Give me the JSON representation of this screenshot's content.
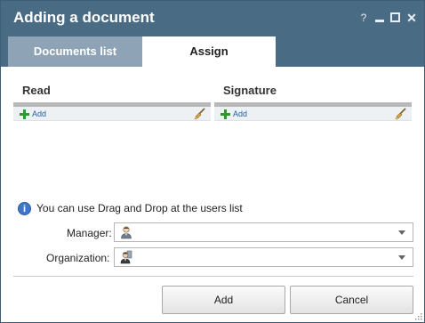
{
  "window": {
    "title": "Adding a document",
    "help_glyph": "?",
    "close_glyph": "✕"
  },
  "tabs": [
    {
      "label": "Documents list",
      "active": false
    },
    {
      "label": "Assign",
      "active": true
    }
  ],
  "panels": {
    "read": {
      "title": "Read",
      "add_label": "Add"
    },
    "signature": {
      "title": "Signature",
      "add_label": "Add"
    }
  },
  "info": {
    "icon": "i",
    "text": "You can use Drag and Drop at the users list"
  },
  "fields": {
    "manager": {
      "label": "Manager:",
      "value": ""
    },
    "organization": {
      "label": "Organization:",
      "value": ""
    }
  },
  "buttons": {
    "add": "Add",
    "cancel": "Cancel"
  },
  "colors": {
    "titlebar": "#4a6b84",
    "inactive_tab": "#8ea4b6",
    "add_icon": "#2e9a2e",
    "link": "#1f5fa8",
    "info_icon": "#3c78c8"
  }
}
